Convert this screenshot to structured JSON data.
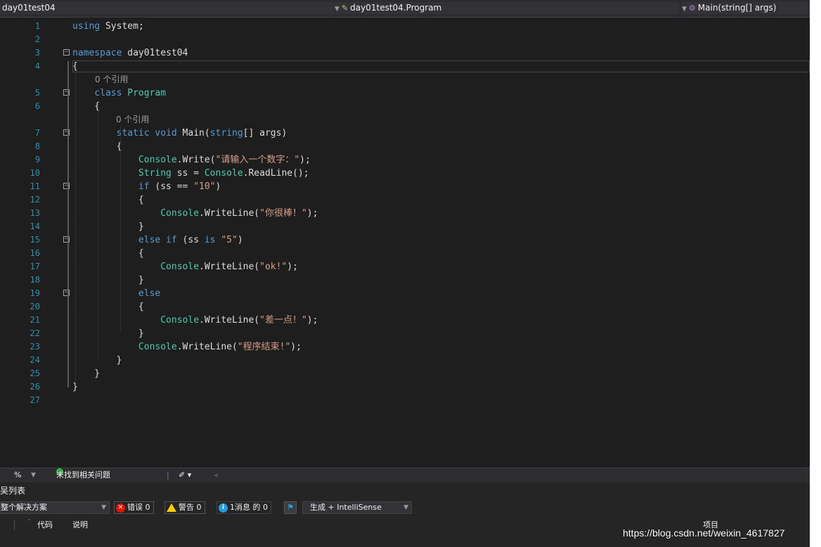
{
  "navbar": {
    "project": "day01test04",
    "class_dropdown": "day01test04.Program",
    "member_dropdown": "Main(string[] args)"
  },
  "editor": {
    "lines": [
      {
        "n": "1",
        "lens": "",
        "segs": [
          [
            "kw",
            "using "
          ],
          [
            "pl",
            "System;"
          ]
        ]
      },
      {
        "n": "2",
        "lens": "",
        "segs": []
      },
      {
        "n": "3",
        "lens": "",
        "segs": [
          [
            "kw",
            "namespace "
          ],
          [
            "pl",
            "day01test04"
          ]
        ]
      },
      {
        "n": "4",
        "lens": "0 个引用",
        "segs": [
          [
            "pl",
            "{"
          ]
        ]
      },
      {
        "n": "5",
        "lens": "",
        "segs": [
          [
            "pl",
            "    "
          ],
          [
            "kw",
            "class "
          ],
          [
            "ty",
            "Program"
          ]
        ]
      },
      {
        "n": "6",
        "lens": "0 个引用",
        "segs": [
          [
            "pl",
            "    {"
          ]
        ]
      },
      {
        "n": "7",
        "lens": "",
        "segs": [
          [
            "pl",
            "        "
          ],
          [
            "kw",
            "static void "
          ],
          [
            "fn",
            "Main"
          ],
          [
            "pl",
            "("
          ],
          [
            "kw",
            "string"
          ],
          [
            "pl",
            "[] args)"
          ]
        ]
      },
      {
        "n": "8",
        "lens": "",
        "segs": [
          [
            "pl",
            "        {"
          ]
        ]
      },
      {
        "n": "9",
        "lens": "",
        "segs": [
          [
            "pl",
            "            "
          ],
          [
            "ty",
            "Console"
          ],
          [
            "pl",
            ".Write("
          ],
          [
            "st",
            "\"请输入一个数字：\""
          ],
          [
            "pl",
            ");"
          ]
        ]
      },
      {
        "n": "10",
        "lens": "",
        "segs": [
          [
            "pl",
            "            "
          ],
          [
            "ty",
            "String"
          ],
          [
            "pl",
            " ss = "
          ],
          [
            "ty",
            "Console"
          ],
          [
            "pl",
            ".ReadLine();"
          ]
        ]
      },
      {
        "n": "11",
        "lens": "",
        "segs": [
          [
            "pl",
            "            "
          ],
          [
            "kw",
            "if "
          ],
          [
            "pl",
            "(ss == "
          ],
          [
            "st",
            "\"10\""
          ],
          [
            "pl",
            ")"
          ]
        ]
      },
      {
        "n": "12",
        "lens": "",
        "segs": [
          [
            "pl",
            "            {"
          ]
        ]
      },
      {
        "n": "13",
        "lens": "",
        "segs": [
          [
            "pl",
            "                "
          ],
          [
            "ty",
            "Console"
          ],
          [
            "pl",
            ".WriteLine("
          ],
          [
            "st",
            "\"你很棒！\""
          ],
          [
            "pl",
            ");"
          ]
        ]
      },
      {
        "n": "14",
        "lens": "",
        "segs": [
          [
            "pl",
            "            }"
          ]
        ]
      },
      {
        "n": "15",
        "lens": "",
        "segs": [
          [
            "pl",
            "            "
          ],
          [
            "kw",
            "else if "
          ],
          [
            "pl",
            "(ss "
          ],
          [
            "kw",
            "is "
          ],
          [
            "st",
            "\"5\""
          ],
          [
            "pl",
            ")"
          ]
        ]
      },
      {
        "n": "16",
        "lens": "",
        "segs": [
          [
            "pl",
            "            {"
          ]
        ]
      },
      {
        "n": "17",
        "lens": "",
        "segs": [
          [
            "pl",
            "                "
          ],
          [
            "ty",
            "Console"
          ],
          [
            "pl",
            ".WriteLine("
          ],
          [
            "st",
            "\"ok!\""
          ],
          [
            "pl",
            ");"
          ]
        ]
      },
      {
        "n": "18",
        "lens": "",
        "segs": [
          [
            "pl",
            "            }"
          ]
        ]
      },
      {
        "n": "19",
        "lens": "",
        "segs": [
          [
            "pl",
            "            "
          ],
          [
            "kw",
            "else"
          ]
        ]
      },
      {
        "n": "20",
        "lens": "",
        "segs": [
          [
            "pl",
            "            {"
          ]
        ]
      },
      {
        "n": "21",
        "lens": "",
        "segs": [
          [
            "pl",
            "                "
          ],
          [
            "ty",
            "Console"
          ],
          [
            "pl",
            ".WriteLine("
          ],
          [
            "st",
            "\"差一点！\""
          ],
          [
            "pl",
            ");"
          ]
        ]
      },
      {
        "n": "22",
        "lens": "",
        "segs": [
          [
            "pl",
            "            }"
          ]
        ]
      },
      {
        "n": "23",
        "lens": "",
        "segs": [
          [
            "pl",
            "            "
          ],
          [
            "ty",
            "Console"
          ],
          [
            "pl",
            ".WriteLine("
          ],
          [
            "st",
            "\"程序结束!\""
          ],
          [
            "pl",
            ");"
          ]
        ]
      },
      {
        "n": "24",
        "lens": "",
        "segs": [
          [
            "pl",
            "        }"
          ]
        ]
      },
      {
        "n": "25",
        "lens": "",
        "segs": [
          [
            "pl",
            "    }"
          ]
        ]
      },
      {
        "n": "26",
        "lens": "",
        "segs": [
          [
            "pl",
            "}"
          ]
        ]
      },
      {
        "n": "27",
        "lens": "",
        "segs": []
      }
    ]
  },
  "strip": {
    "zoom": "%",
    "issues": "未找到相关问题"
  },
  "error_list": {
    "title": "吴列表",
    "scope": "整个解决方案",
    "errors": "错误 0",
    "warnings": "警告 0",
    "messages": "1消息 的 0",
    "build": "生成 + IntelliSense",
    "col_code": "代码",
    "col_desc": "说明",
    "col_project": "项目"
  },
  "watermark": "https://blog.csdn.net/weixin_4617827",
  "colors": {
    "editor_bg": "#1e1e1e",
    "keyword": "#569cd6",
    "type": "#4ec9b0",
    "string": "#d69d85",
    "line_number": "#2b91af"
  }
}
